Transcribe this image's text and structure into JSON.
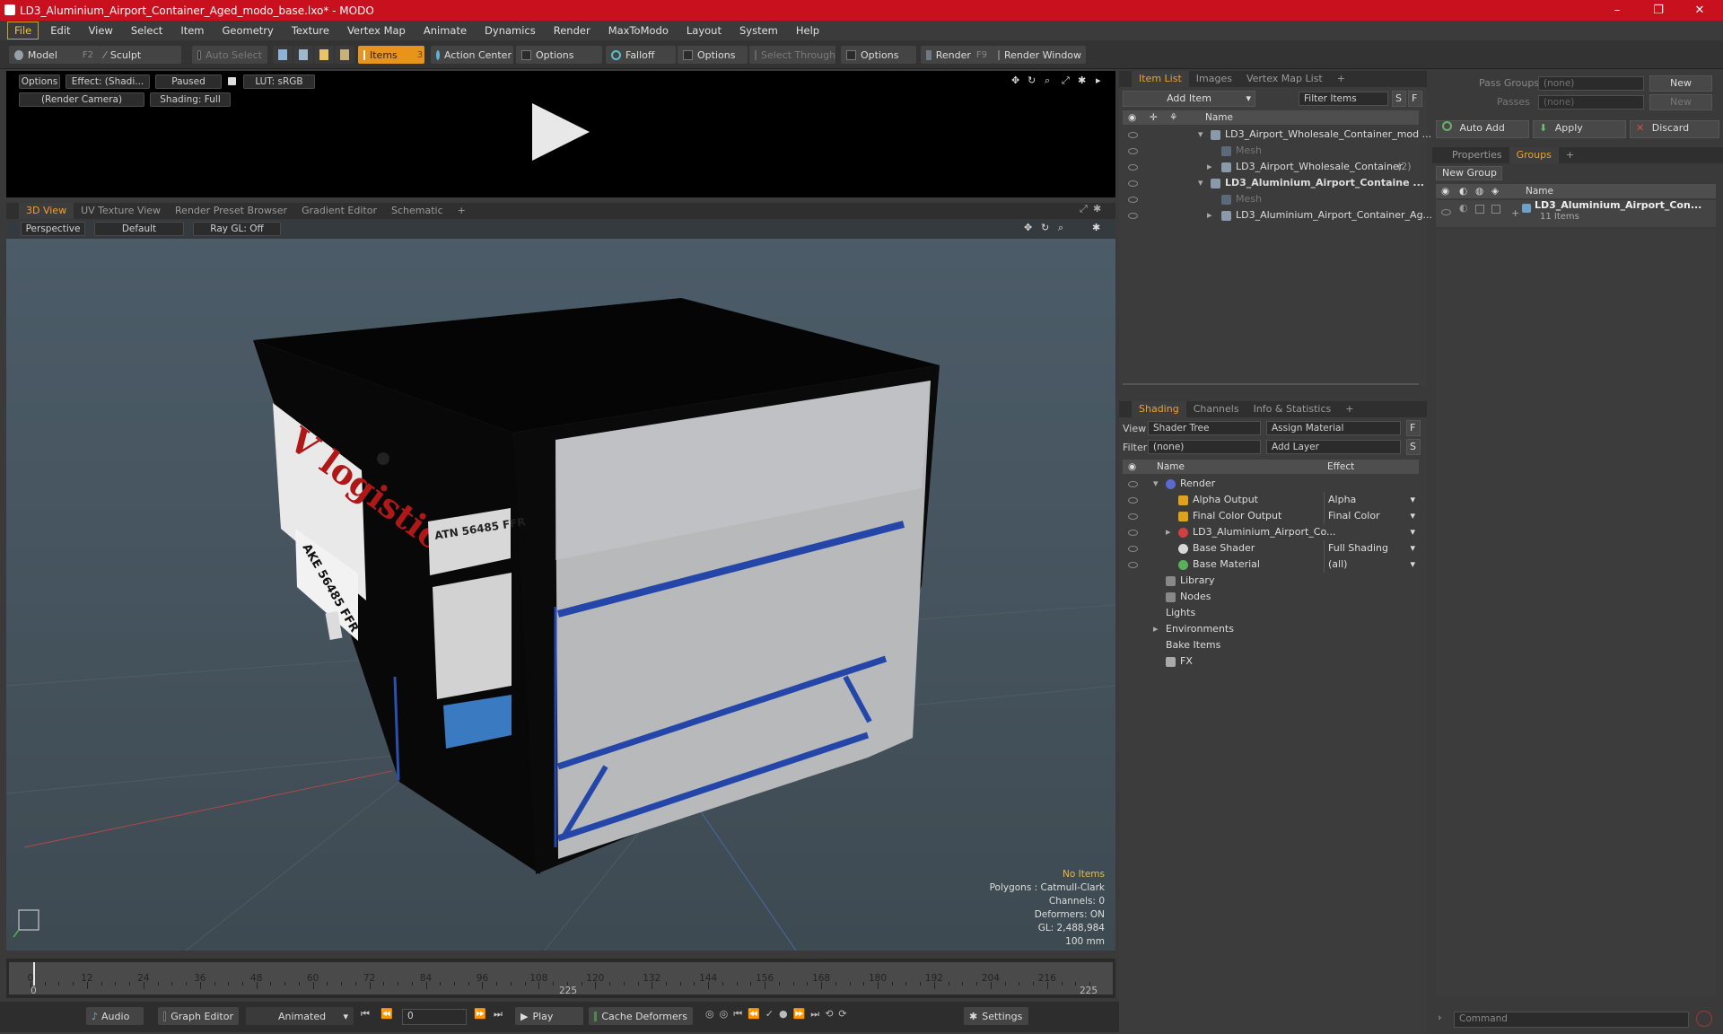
{
  "window": {
    "title": "LD3_Aluminium_Airport_Container_Aged_modo_base.lxo* - MODO",
    "controls": [
      "–",
      "❐",
      "✕"
    ]
  },
  "menu": [
    "File",
    "Edit",
    "View",
    "Select",
    "Item",
    "Geometry",
    "Texture",
    "Vertex Map",
    "Animate",
    "Dynamics",
    "Render",
    "MaxToModo",
    "Layout",
    "System",
    "Help"
  ],
  "toolbar": {
    "model": "Model",
    "model_key": "F2",
    "sculpt": "Sculpt",
    "auto_select": "Auto Select",
    "items": "Items",
    "items_key": "3",
    "action_center": "Action Center",
    "options1": "Options",
    "falloff": "Falloff",
    "options2": "Options",
    "select_through": "Select Through",
    "options3": "Options",
    "render": "Render",
    "render_key": "F9",
    "render_window": "Render Window"
  },
  "preview": {
    "options": "Options",
    "effect": "Effect: (Shadi...",
    "paused": "Paused",
    "lut": "LUT: sRGB",
    "camera": "(Render Camera)",
    "shading": "Shading: Full"
  },
  "viewport_tabs": [
    "3D View",
    "UV Texture View",
    "Render Preset Browser",
    "Gradient Editor",
    "Schematic",
    "+"
  ],
  "viewport": {
    "view_mode": "Perspective",
    "style": "Default",
    "raygl": "Ray GL: Off",
    "info": {
      "selection": "No Items",
      "polygons": "Polygons : Catmull-Clark",
      "channels": "Channels: 0",
      "deformers": "Deformers: ON",
      "gl": "GL: 2,488,984",
      "scale": "100 mm"
    },
    "labels": {
      "brand": "V logistics",
      "code": "AKE 56485 FFR",
      "plate": "ATN 56485 FFR"
    }
  },
  "timeline": {
    "ticks": [
      0,
      12,
      24,
      36,
      48,
      60,
      72,
      84,
      96,
      108,
      120,
      132,
      144,
      156,
      168,
      180,
      192,
      204,
      216
    ],
    "start": "0",
    "end": "225",
    "mid": "225"
  },
  "transport": {
    "audio": "Audio",
    "graph_editor": "Graph Editor",
    "animated": "Animated",
    "frame": "0",
    "play": "Play",
    "cache_deformers": "Cache Deformers",
    "settings": "Settings"
  },
  "item_list": {
    "tabs": [
      "Item List",
      "Images",
      "Vertex Map List",
      "+"
    ],
    "add_item": "Add Item",
    "filter": "Filter Items",
    "s_btn": "S",
    "f_btn": "F",
    "col_name": "Name",
    "rows": [
      {
        "label": "LD3_Airport_Wholesale_Container_mod ...",
        "level": 0,
        "bold": false,
        "dim": false
      },
      {
        "label": "Mesh",
        "level": 1,
        "bold": false,
        "dim": true
      },
      {
        "label": "LD3_Airport_Wholesale_Container",
        "suffix": "(2)",
        "level": 1,
        "bold": false,
        "dim": false
      },
      {
        "label": "LD3_Aluminium_Airport_Containe ...",
        "level": 0,
        "bold": true,
        "dim": false
      },
      {
        "label": "Mesh",
        "level": 1,
        "bold": false,
        "dim": true
      },
      {
        "label": "LD3_Aluminium_Airport_Container_Ag...",
        "level": 1,
        "bold": false,
        "dim": false
      }
    ]
  },
  "shading": {
    "tabs": [
      "Shading",
      "Channels",
      "Info & Statistics",
      "+"
    ],
    "view_label": "View",
    "view_value": "Shader Tree",
    "assign_material": "Assign Material",
    "filter_label": "Filter",
    "filter_value": "(none)",
    "add_layer": "Add Layer",
    "f_btn": "F",
    "s_btn": "S",
    "col_name": "Name",
    "col_effect": "Effect",
    "rows": [
      {
        "name": "Render",
        "effect": "",
        "indent": 0,
        "icon": "render-icon"
      },
      {
        "name": "Alpha Output",
        "effect": "Alpha",
        "indent": 1,
        "icon": "output-icon"
      },
      {
        "name": "Final Color Output",
        "effect": "Final Color",
        "indent": 1,
        "icon": "output-icon"
      },
      {
        "name": "LD3_Aluminium_Airport_Co...",
        "effect": "",
        "indent": 1,
        "icon": "material-group-icon"
      },
      {
        "name": "Base Shader",
        "effect": "Full Shading",
        "indent": 1,
        "icon": "shader-icon"
      },
      {
        "name": "Base Material",
        "effect": "(all)",
        "indent": 1,
        "icon": "material-icon"
      },
      {
        "name": "Library",
        "effect": "",
        "indent": 0,
        "icon": "folder-icon"
      },
      {
        "name": "Nodes",
        "effect": "",
        "indent": 0,
        "icon": "folder-icon"
      },
      {
        "name": "Lights",
        "effect": "",
        "indent": 0,
        "icon": ""
      },
      {
        "name": "Environments",
        "effect": "",
        "indent": 0,
        "icon": ""
      },
      {
        "name": "Bake Items",
        "effect": "",
        "indent": 0,
        "icon": ""
      },
      {
        "name": "FX",
        "effect": "",
        "indent": 0,
        "icon": "fx-icon"
      }
    ]
  },
  "groups_panel": {
    "pass_groups_label": "Pass Groups",
    "pass_groups_value": "(none)",
    "passes_label": "Passes",
    "passes_value": "(none)",
    "new_btn": "New",
    "new_btn2": "New",
    "auto_add": "Auto Add",
    "apply": "Apply",
    "discard": "Discard",
    "tabs": [
      "Properties",
      "Groups",
      "+"
    ],
    "new_group": "New Group",
    "col_name": "Name",
    "group_name": "LD3_Aluminium_Airport_Con...",
    "group_count": "11 Items"
  },
  "command": {
    "placeholder": "Command"
  },
  "colors": {
    "title_red": "#c8101e",
    "accent_orange": "#e8941a",
    "tab_orange": "#f0a030"
  }
}
